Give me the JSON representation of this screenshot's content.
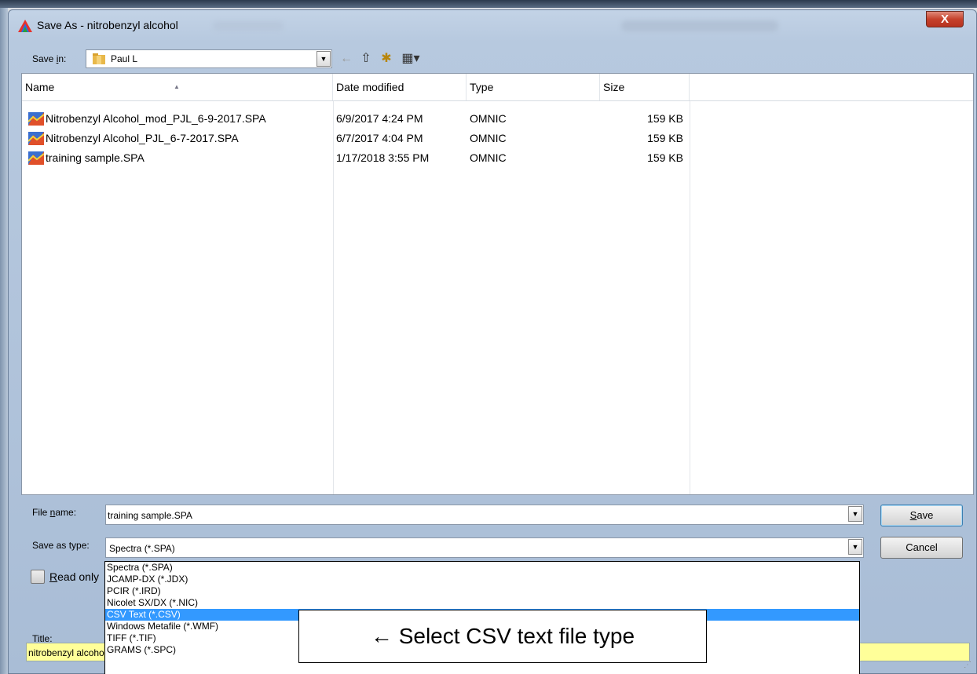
{
  "window": {
    "title": "Save As - nitrobenzyl alcohol",
    "close_glyph": "X"
  },
  "save_in": {
    "label_pre": "Save ",
    "label_u": "i",
    "label_post": "n:",
    "value": "Paul L",
    "icon": "folder-icon"
  },
  "toolbar": {
    "back_icon": "←",
    "up_icon": "⇧",
    "new_folder_icon": "✱",
    "view_menu_icon": "▦▾"
  },
  "columns": [
    "Name",
    "Date modified",
    "Type",
    "Size"
  ],
  "files": [
    {
      "name": "Nitrobenzyl Alcohol_mod_PJL_6-9-2017.SPA",
      "date": "6/9/2017 4:24 PM",
      "type": "OMNIC",
      "size": "159 KB"
    },
    {
      "name": "Nitrobenzyl Alcohol_PJL_6-7-2017.SPA",
      "date": "6/7/2017 4:04 PM",
      "type": "OMNIC",
      "size": "159 KB"
    },
    {
      "name": "training sample.SPA",
      "date": "1/17/2018 3:55 PM",
      "type": "OMNIC",
      "size": "159 KB"
    }
  ],
  "file_name": {
    "label_pre": "File ",
    "label_u": "n",
    "label_post": "ame:",
    "value": "training sample.SPA"
  },
  "save_type": {
    "label": "Save as type:",
    "value": "Spectra (*.SPA)",
    "options": [
      "Spectra (*.SPA)",
      "JCAMP-DX (*.JDX)",
      "PCIR (*.IRD)",
      "Nicolet SX/DX (*.NIC)",
      "CSV Text (*.CSV)",
      "Windows Metafile (*.WMF)",
      "TIFF (*.TIF)",
      "GRAMS (*.SPC)"
    ],
    "selected_index": 4
  },
  "buttons": {
    "save_u": "S",
    "save_rest": "ave",
    "cancel": "Cancel"
  },
  "read_only": {
    "label_u": "R",
    "label_rest": "ead only"
  },
  "title_field": {
    "label": "Title:",
    "value": "nitrobenzyl alcohol"
  },
  "callout": {
    "text": "← Select CSV text file type"
  },
  "colors": {
    "selection": "#3399ff",
    "title_field_bg": "#ffff99",
    "close_button": "#c6412c"
  }
}
